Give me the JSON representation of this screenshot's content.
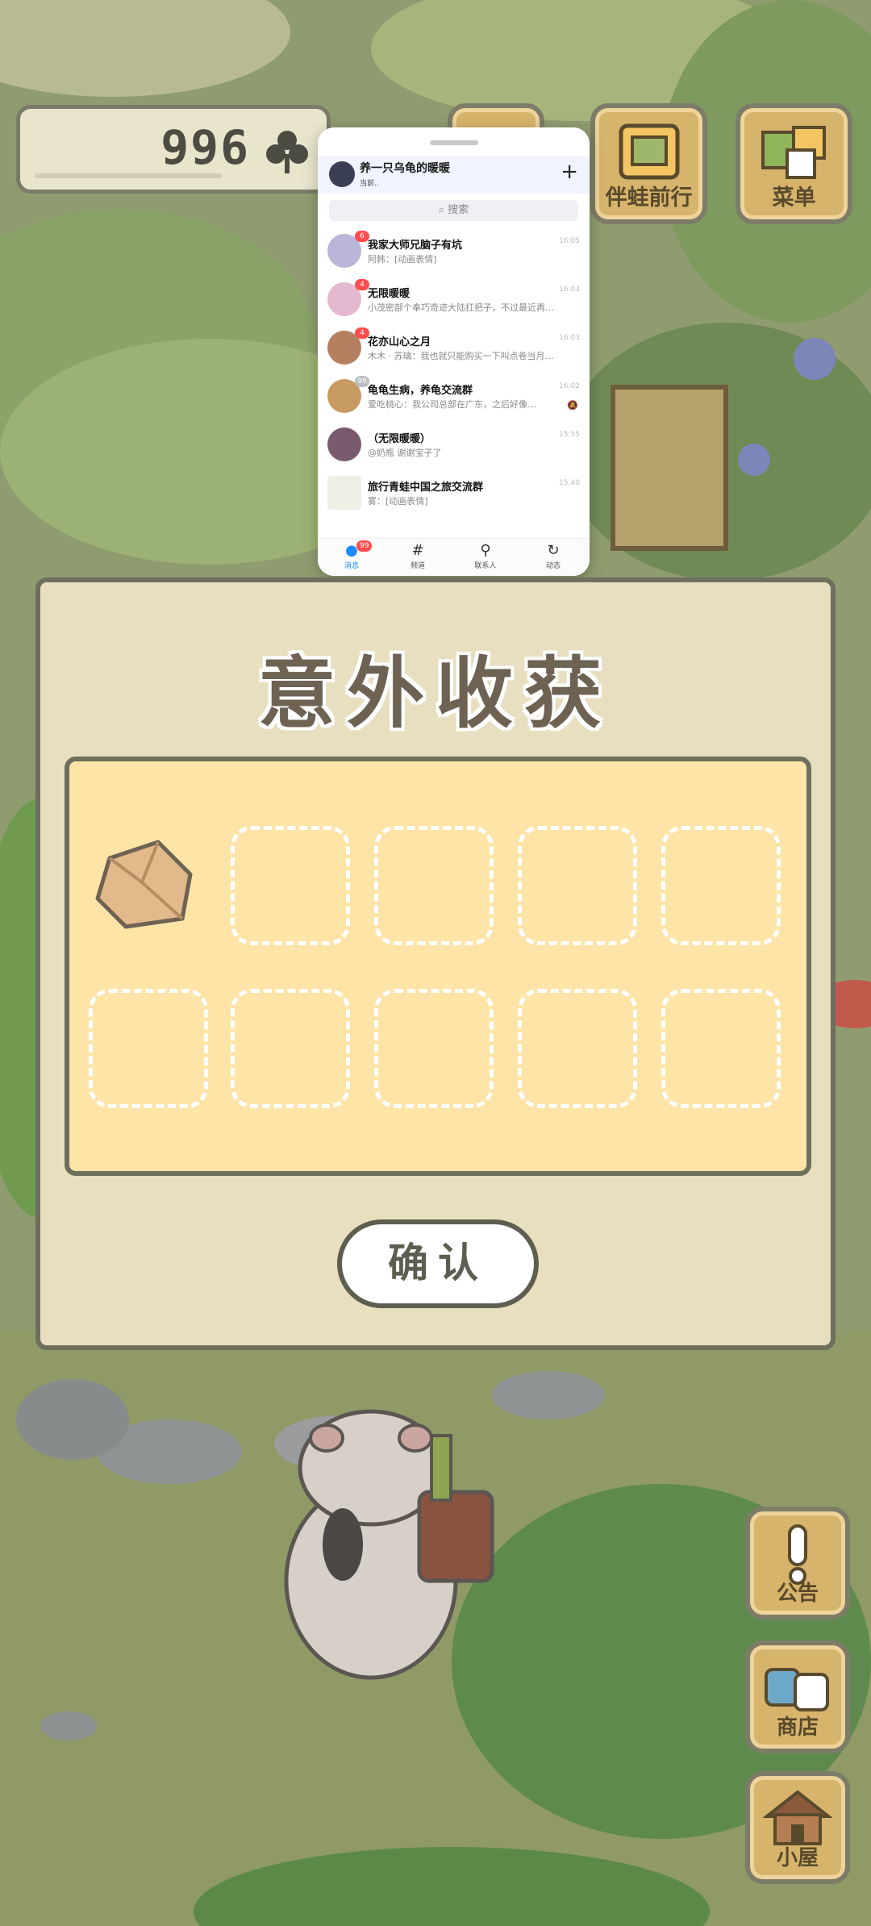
{
  "game": {
    "clover_count": "996",
    "top_buttons": [
      {
        "label": "伴蛙前行"
      },
      {
        "label": "菜单"
      }
    ],
    "side_buttons": [
      {
        "label": "公告"
      },
      {
        "label": "商店"
      },
      {
        "label": "小屋"
      }
    ]
  },
  "dialog": {
    "title": "意外收获",
    "confirm_label": "确认",
    "slots_total": 10,
    "items": [
      {
        "name": "stone",
        "icon": "stone-icon"
      }
    ]
  },
  "chat": {
    "account_name": "养一只乌龟的暖暖",
    "account_status": "当前..",
    "search_placeholder": "搜索",
    "conversations": [
      {
        "name": "我家大师兄脑子有坑",
        "preview": "阿韩：[动画表情]",
        "badge": "6",
        "time": "16:05"
      },
      {
        "name": "无限暖暖",
        "preview": "小茂密部个奉巧奇迹大陆扛把子，不过最近再…",
        "badge": "4",
        "time": "16:03"
      },
      {
        "name": "花亦山心之月",
        "preview": "木木 · 苏璃：我也就只能购买一下叫点卷当月…",
        "badge": "4",
        "time": "16:03"
      },
      {
        "name": "龟龟生病，养龟交流群",
        "preview": "爱吃桃心：我公司总部在广东，之后好像…",
        "badge": "99",
        "time": "16:02"
      },
      {
        "name": "（无限暖暖）",
        "preview": "@奶瓶 谢谢宝子了",
        "badge": "",
        "time": "15:55"
      },
      {
        "name": "旅行青蛙中国之旅交流群",
        "preview": "雾：[动画表情]",
        "badge": "",
        "time": "15:40"
      }
    ],
    "nav": [
      {
        "label": "消息",
        "badge": "99"
      },
      {
        "label": "频道"
      },
      {
        "label": "联系人"
      },
      {
        "label": "动态"
      }
    ]
  },
  "colors": {
    "dialog_bg": "#e8dec0",
    "grid_bg": "#ffe4a8",
    "outline": "#6e6f5d",
    "wood": "#d6b46c",
    "chat_accent": "#1a8cff",
    "badge_red": "#ff4d4f"
  }
}
